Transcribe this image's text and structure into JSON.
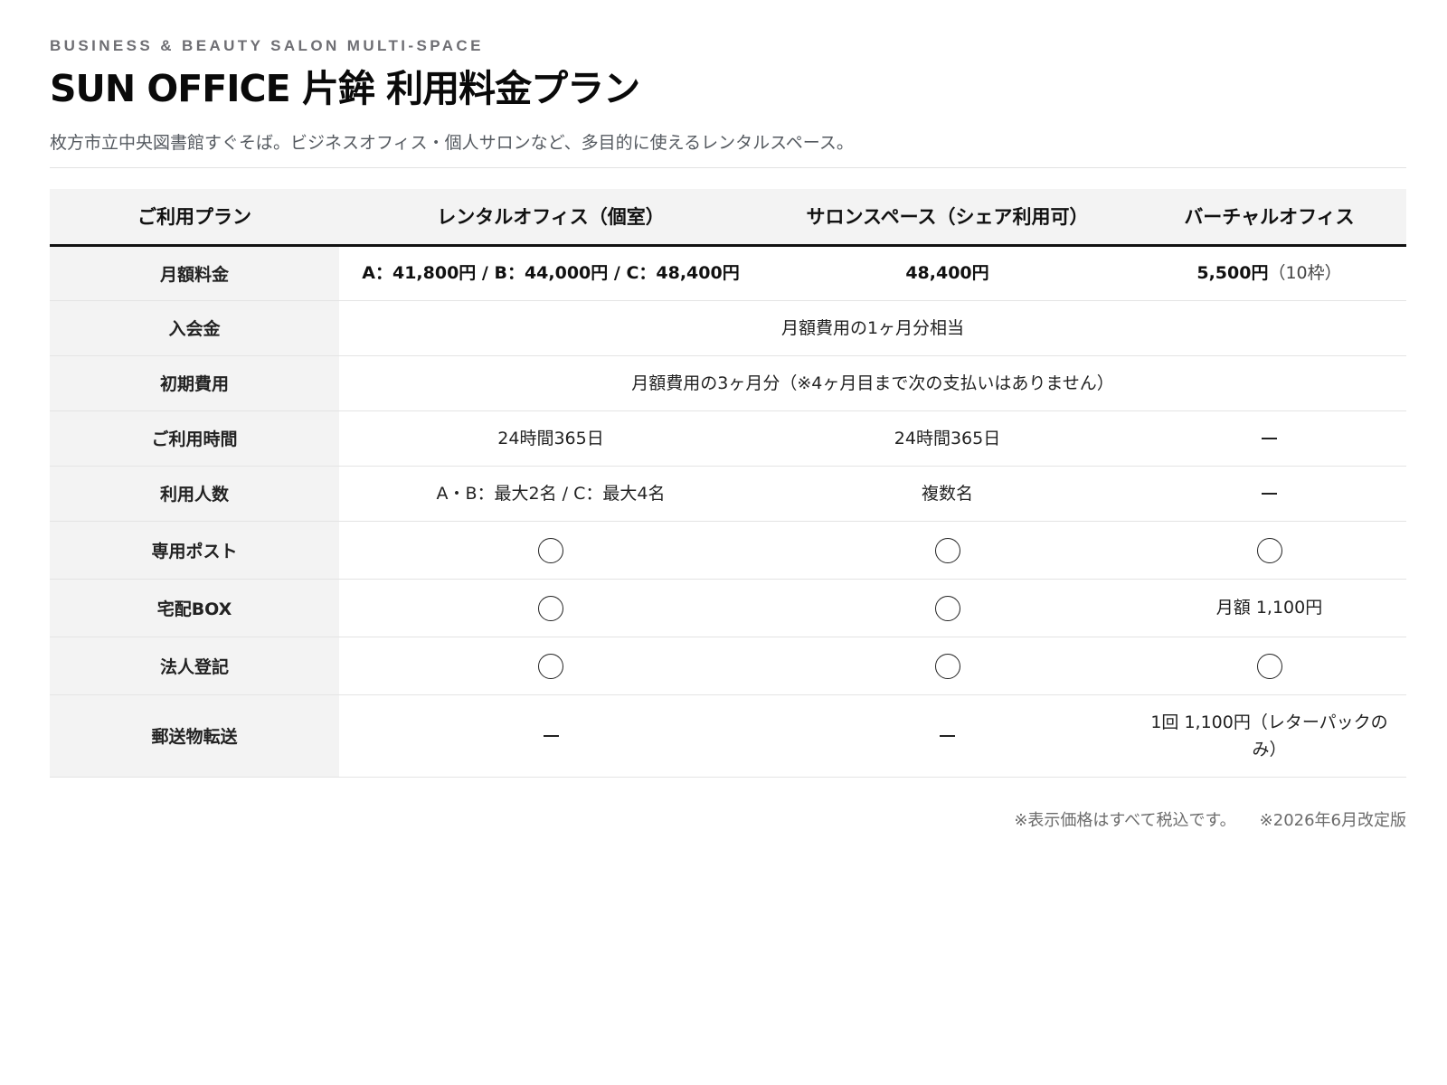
{
  "header": {
    "eyebrow": "BUSINESS & BEAUTY SALON MULTI-SPACE",
    "title": "SUN OFFICE 片鉾 利用料金プラン",
    "subtitle": "枚方市立中央図書館すぐそば。ビジネスオフィス・個人サロンなど、多目的に使えるレンタルスペース。"
  },
  "table": {
    "columns": [
      "ご利用プラン",
      "レンタルオフィス（個室）",
      "サロンスペース（シェア利用可）",
      "バーチャルオフィス"
    ],
    "rows": {
      "monthly": {
        "label": "月額料金",
        "office": "A：41,800円 / B：44,000円 / C：48,400円",
        "salon": "48,400円",
        "virtual_price": "5,500円",
        "virtual_note": "（10枠）"
      },
      "admission": {
        "label": "入会金",
        "all": "月額費用の1ヶ月分相当"
      },
      "initial": {
        "label": "初期費用",
        "all": "月額費用の3ヶ月分（※4ヶ月目まで次の支払いはありません）"
      },
      "hours": {
        "label": "ご利用時間",
        "office": "24時間365日",
        "salon": "24時間365日",
        "virtual": "dash"
      },
      "people": {
        "label": "利用人数",
        "office": "A・B：最大2名 / C：最大4名",
        "salon": "複数名",
        "virtual": "dash"
      },
      "post": {
        "label": "専用ポスト",
        "office": "circle",
        "salon": "circle",
        "virtual": "circle"
      },
      "delivery_box": {
        "label": "宅配BOX",
        "office": "circle",
        "salon": "circle",
        "virtual": "月額 1,100円"
      },
      "registration": {
        "label": "法人登記",
        "office": "circle",
        "salon": "circle",
        "virtual": "circle"
      },
      "forwarding": {
        "label": "郵送物転送",
        "office": "dash",
        "salon": "dash",
        "virtual": "1回 1,100円（レターパックのみ）"
      }
    }
  },
  "footnotes": {
    "tax": "※表示価格はすべて税込です。",
    "revision": "※2026年6月改定版"
  },
  "icons": {
    "available": "circle-icon",
    "not_applicable": "dash-icon"
  }
}
